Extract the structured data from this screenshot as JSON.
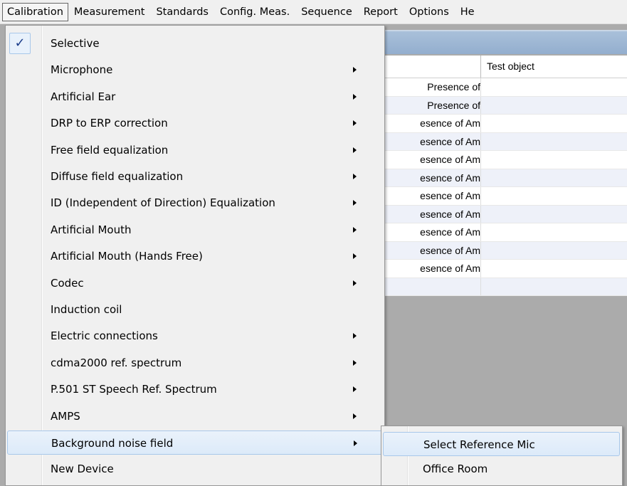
{
  "menubar": {
    "items": [
      "Calibration",
      "Measurement",
      "Standards",
      "Config. Meas.",
      "Sequence",
      "Report",
      "Options",
      "He"
    ]
  },
  "grid": {
    "header_col2": "Test object",
    "rows": [
      "Presence of",
      "Presence of",
      "esence of Am",
      "esence of Am",
      "esence of Am",
      "esence of Am",
      "esence of Am",
      "esence of Am",
      "esence of Am",
      "esence of Am",
      "esence of Am",
      ""
    ]
  },
  "menu": {
    "checked_mark": "✓",
    "items": [
      {
        "label": "Selective",
        "submenu": false,
        "checked": true
      },
      {
        "label": "Microphone",
        "submenu": true
      },
      {
        "label": "Artificial Ear",
        "submenu": true
      },
      {
        "label": "DRP to ERP correction",
        "submenu": true
      },
      {
        "label": "Free field equalization",
        "submenu": true
      },
      {
        "label": "Diffuse field equalization",
        "submenu": true
      },
      {
        "label": "ID (Independent of Direction) Equalization",
        "submenu": true
      },
      {
        "label": "Artificial Mouth",
        "submenu": true
      },
      {
        "label": "Artificial Mouth (Hands Free)",
        "submenu": true
      },
      {
        "label": "Codec",
        "submenu": true
      },
      {
        "label": "Induction coil",
        "submenu": false
      },
      {
        "label": "Electric connections",
        "submenu": true
      },
      {
        "label": "cdma2000 ref. spectrum",
        "submenu": true
      },
      {
        "label": "P.501 ST Speech Ref. Spectrum",
        "submenu": true
      },
      {
        "label": "AMPS",
        "submenu": true
      },
      {
        "label": "Background noise field",
        "submenu": true,
        "highlighted": true
      },
      {
        "label": "New Device",
        "submenu": false
      }
    ]
  },
  "submenu": {
    "items": [
      {
        "label": "Select Reference Mic",
        "highlighted": true
      },
      {
        "label": "Office Room"
      }
    ]
  }
}
